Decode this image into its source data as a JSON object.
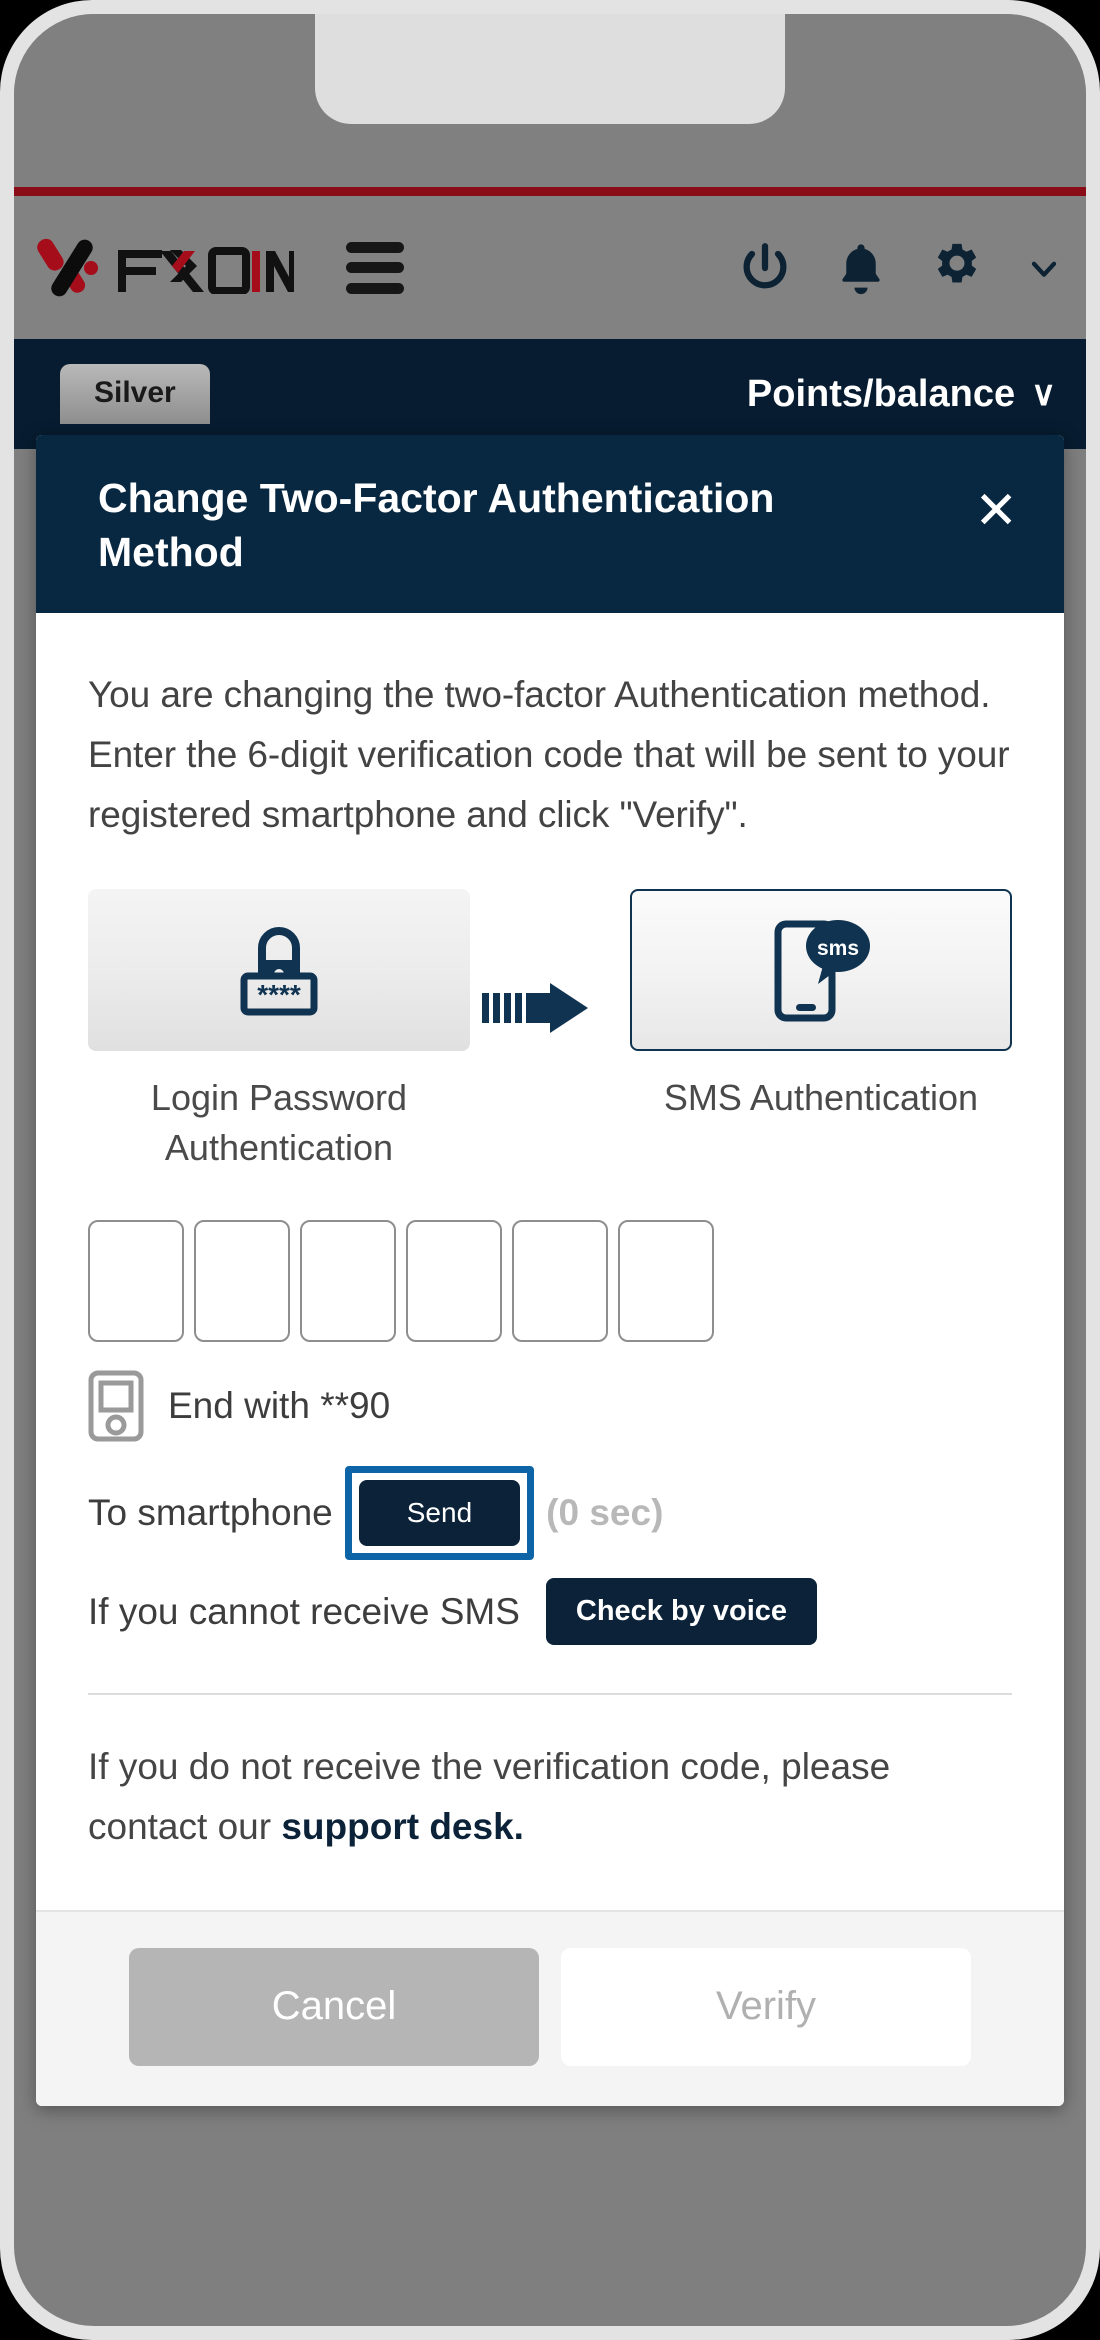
{
  "brand": {
    "logo_text": "FXON",
    "accent_red": "#8a0c17",
    "navy": "#0b2238"
  },
  "header": {
    "menu_icon": "hamburger-icon",
    "actions": [
      {
        "icon": "power-icon",
        "label": "Power"
      },
      {
        "icon": "bell-icon",
        "label": "Notifications"
      },
      {
        "icon": "gear-icon",
        "label": "Settings"
      },
      {
        "icon": "chevron-down-icon",
        "label": "More"
      }
    ]
  },
  "points_bar": {
    "tier_badge": "Silver",
    "points_label": "Points/balance",
    "caret": "∨"
  },
  "modal": {
    "title": "Change Two-Factor Authentication Method",
    "close_label": "✕",
    "description": "You are changing the two-factor Authentication method. Enter the 6-digit verification code that will be sent to your registered smartphone and click \"Verify\".",
    "methods": {
      "from": {
        "label": "Login Password Authentication",
        "icon": "password-lock-icon",
        "mask": "****"
      },
      "to": {
        "label": "SMS Authentication",
        "icon": "sms-phone-icon",
        "badge": "sms"
      },
      "transition_icon": "arrow-right-icon"
    },
    "otp": {
      "digits": 6,
      "values": [
        "",
        "",
        "",
        "",
        "",
        ""
      ]
    },
    "destination": {
      "icon": "mobile-phone-icon",
      "text": "End with **90"
    },
    "send_row": {
      "label": "To smartphone",
      "button_label": "Send",
      "timer": "(0 sec)",
      "highlight_color": "#0d65a8"
    },
    "voice_row": {
      "label": "If you cannot receive SMS",
      "button_label": "Check by voice"
    },
    "support_note": {
      "text_before": "If you do not receive the verification code, please contact our ",
      "link_text": "support desk."
    },
    "footer": {
      "cancel_label": "Cancel",
      "verify_label": "Verify"
    }
  },
  "annotation": {
    "arrow_icon": "curved-arrow-icon",
    "color": "#0d65a8"
  }
}
